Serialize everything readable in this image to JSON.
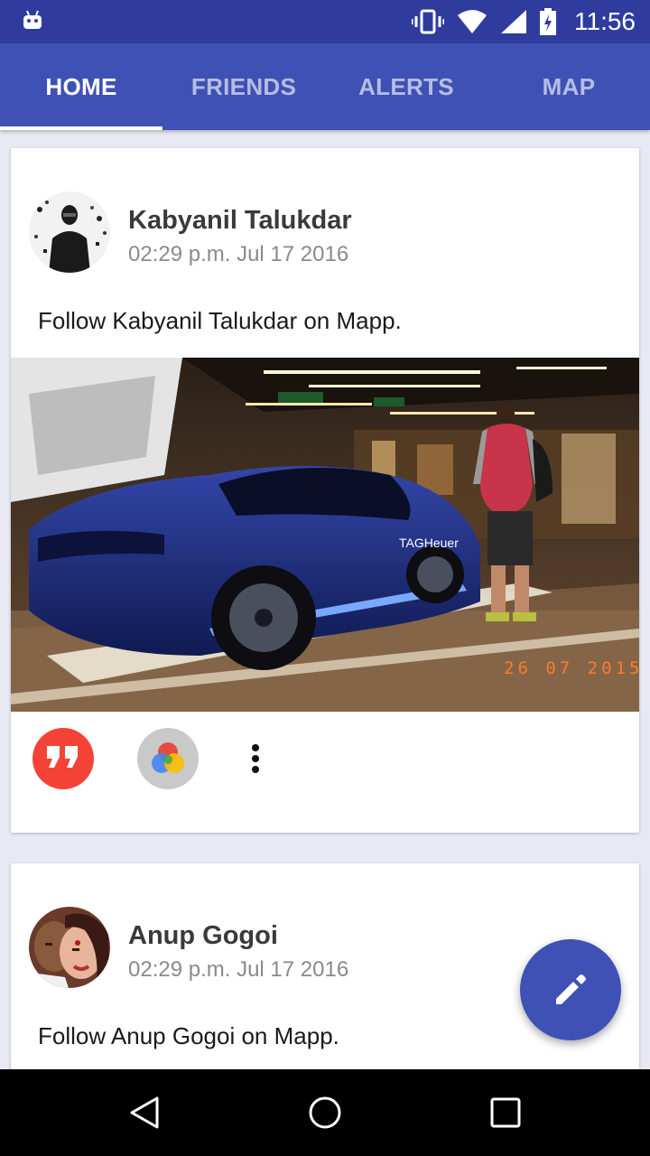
{
  "status_bar": {
    "time": "11:56",
    "icons": [
      "android-notification-icon",
      "vibrate-icon",
      "wifi-icon",
      "signal-icon",
      "battery-charging-icon"
    ]
  },
  "tabs": [
    {
      "label": "HOME",
      "active": true
    },
    {
      "label": "FRIENDS",
      "active": false
    },
    {
      "label": "ALERTS",
      "active": false
    },
    {
      "label": "MAP",
      "active": false
    }
  ],
  "posts": [
    {
      "author": "Kabyanil Talukdar",
      "timestamp": "02:29 p.m. Jul 17 2016",
      "text": "Follow Kabyanil Talukdar on Mapp.",
      "image_caption_stamp": "26 07 2015",
      "image_brand_text": "TAGHeuer",
      "actions": [
        "quote-icon",
        "photos-icon",
        "more-vert-icon"
      ]
    },
    {
      "author": "Anup Gogoi",
      "timestamp": "02:29 p.m. Jul 17 2016",
      "text": "Follow Anup Gogoi on Mapp."
    }
  ],
  "fab": {
    "icon": "edit-pencil-icon"
  },
  "nav_bar": {
    "buttons": [
      "back-icon",
      "home-icon",
      "recents-icon"
    ]
  },
  "colors": {
    "status_bar": "#2f3c9e",
    "app_bar": "#3f51b5",
    "background": "#e8e9f3",
    "quote_button": "#f44336",
    "fab": "#3f51b5"
  }
}
